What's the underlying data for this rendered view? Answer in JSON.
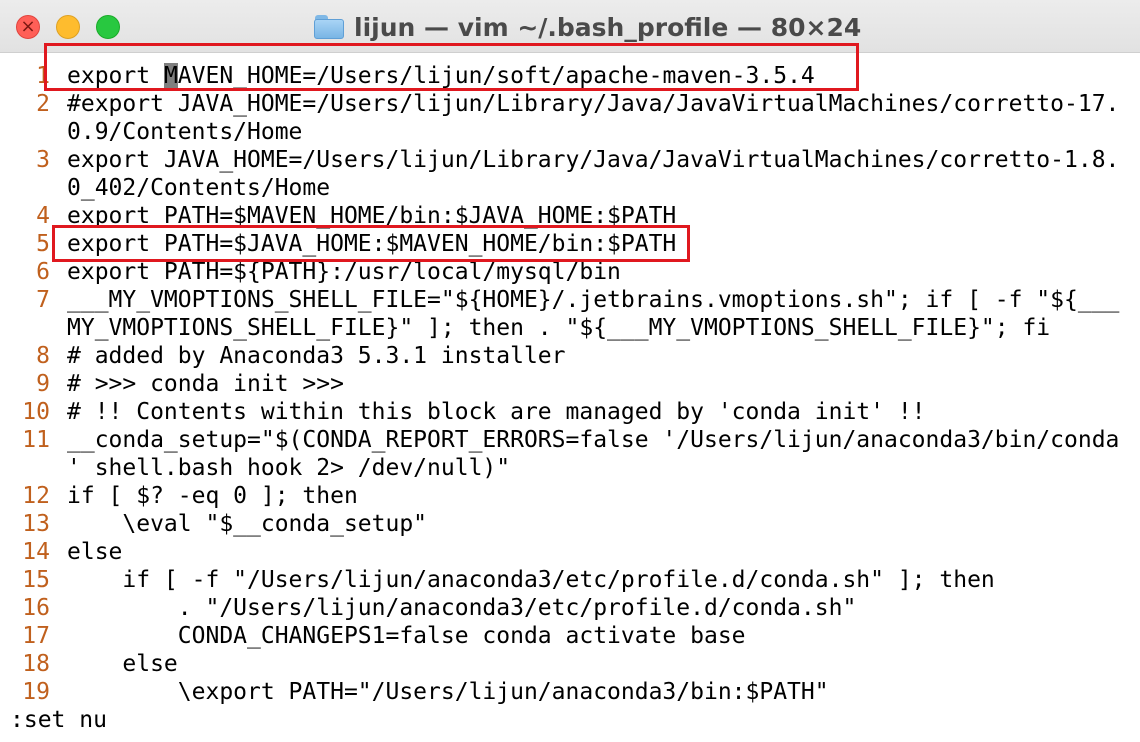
{
  "window": {
    "title": "lijun — vim ~/.bash_profile — 80×24",
    "title_icon": "folder-icon",
    "controls": [
      "close-icon",
      "minimize-icon",
      "zoom-icon"
    ]
  },
  "editor": {
    "first_line_prefix": "export ",
    "cursor_char": "M",
    "first_line_rest": "AVEN_HOME=/Users/lijun/soft/apache-maven-3.5.4",
    "rows": [
      {
        "ln": "1",
        "text": ""
      },
      {
        "ln": "2",
        "text": "#export JAVA_HOME=/Users/lijun/Library/Java/JavaVirtualMachines/corretto-17."
      },
      {
        "ln": "",
        "text": "0.9/Contents/Home"
      },
      {
        "ln": "3",
        "text": "export JAVA_HOME=/Users/lijun/Library/Java/JavaVirtualMachines/corretto-1.8."
      },
      {
        "ln": "",
        "text": "0_402/Contents/Home"
      },
      {
        "ln": "4",
        "text": "export PATH=$MAVEN_HOME/bin:$JAVA_HOME:$PATH"
      },
      {
        "ln": "5",
        "text": "export PATH=$JAVA_HOME:$MAVEN_HOME/bin:$PATH"
      },
      {
        "ln": "6",
        "text": "export PATH=${PATH}:/usr/local/mysql/bin"
      },
      {
        "ln": "7",
        "text": "___MY_VMOPTIONS_SHELL_FILE=\"${HOME}/.jetbrains.vmoptions.sh\"; if [ -f \"${___"
      },
      {
        "ln": "",
        "text": "MY_VMOPTIONS_SHELL_FILE}\" ]; then . \"${___MY_VMOPTIONS_SHELL_FILE}\"; fi"
      },
      {
        "ln": "8",
        "text": "# added by Anaconda3 5.3.1 installer"
      },
      {
        "ln": "9",
        "text": "# >>> conda init >>>"
      },
      {
        "ln": "10",
        "text": "# !! Contents within this block are managed by 'conda init' !!"
      },
      {
        "ln": "11",
        "text": "__conda_setup=\"$(CONDA_REPORT_ERRORS=false '/Users/lijun/anaconda3/bin/conda"
      },
      {
        "ln": "",
        "text": "' shell.bash hook 2> /dev/null)\""
      },
      {
        "ln": "12",
        "text": "if [ $? -eq 0 ]; then"
      },
      {
        "ln": "13",
        "text": "    \\eval \"$__conda_setup\""
      },
      {
        "ln": "14",
        "text": "else"
      },
      {
        "ln": "15",
        "text": "    if [ -f \"/Users/lijun/anaconda3/etc/profile.d/conda.sh\" ]; then"
      },
      {
        "ln": "16",
        "text": "        . \"/Users/lijun/anaconda3/etc/profile.d/conda.sh\""
      },
      {
        "ln": "17",
        "text": "        CONDA_CHANGEPS1=false conda activate base"
      },
      {
        "ln": "18",
        "text": "    else"
      },
      {
        "ln": "19",
        "text": "        \\export PATH=\"/Users/lijun/anaconda3/bin:$PATH\""
      }
    ],
    "command_line": ":set nu",
    "highlight_color": "#e0181f",
    "line_number_color": "#c0601d"
  }
}
